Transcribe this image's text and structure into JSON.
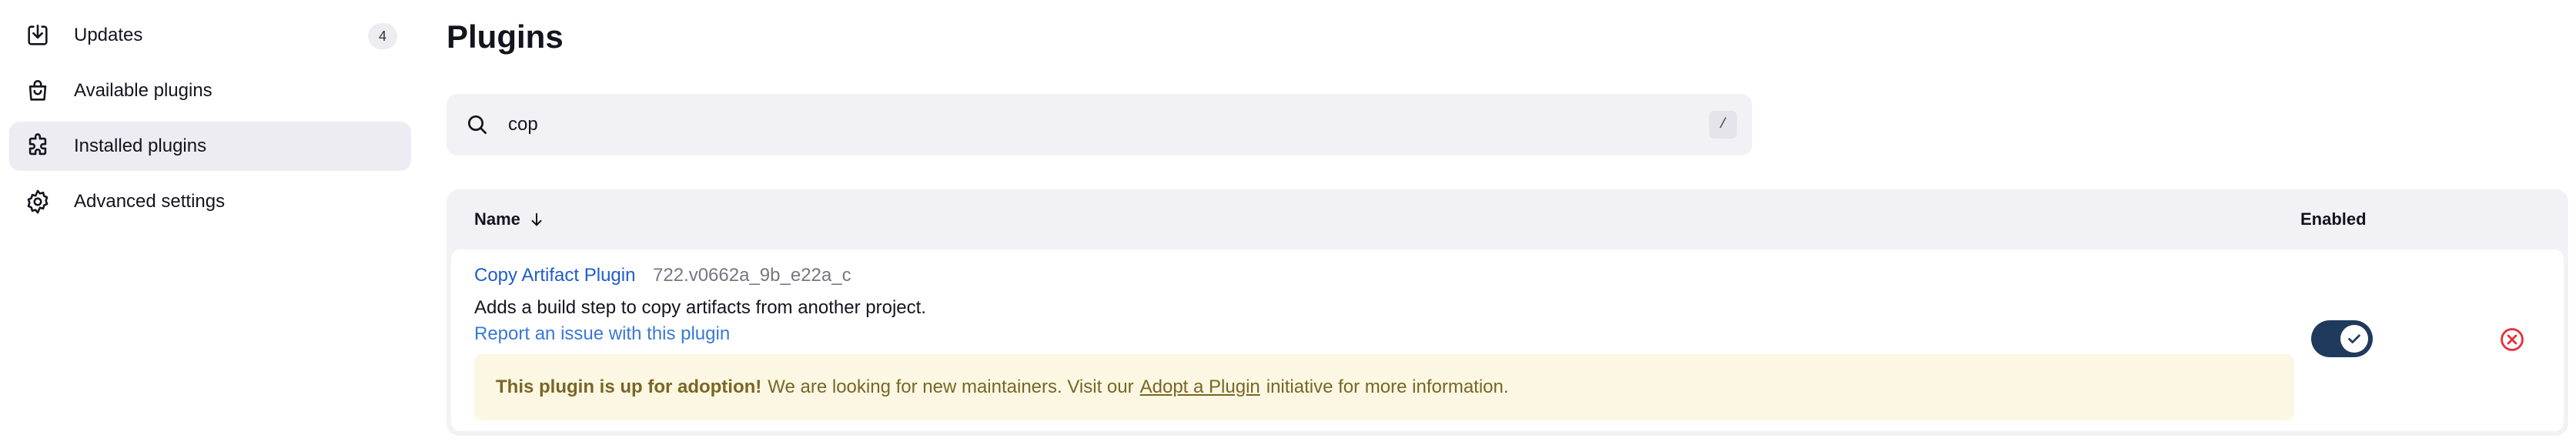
{
  "sidebar": {
    "items": [
      {
        "label": "Updates",
        "icon": "download-icon",
        "badge": "4",
        "active": false
      },
      {
        "label": "Available plugins",
        "icon": "shopping-bag-icon",
        "active": false
      },
      {
        "label": "Installed plugins",
        "icon": "puzzle-icon",
        "active": true
      },
      {
        "label": "Advanced settings",
        "icon": "gear-icon",
        "active": false
      }
    ]
  },
  "main": {
    "title": "Plugins",
    "search": {
      "value": "cop",
      "shortcut": "/"
    },
    "table": {
      "columns": {
        "name": "Name",
        "enabled": "Enabled"
      },
      "rows": [
        {
          "name": "Copy Artifact Plugin",
          "version": "722.v0662a_9b_e22a_c",
          "description": "Adds a build step to copy artifacts from another project.",
          "report_link": "Report an issue with this plugin",
          "adoption": {
            "bold": "This plugin is up for adoption!",
            "text_before": "We are looking for new maintainers. Visit our",
            "link": "Adopt a Plugin",
            "text_after": "initiative for more information."
          },
          "enabled": true
        }
      ]
    }
  },
  "colors": {
    "accent": "#1f3a5c",
    "link": "#1f5cc9",
    "danger": "#e5303a",
    "adoption_bg": "#fbf7e2"
  }
}
